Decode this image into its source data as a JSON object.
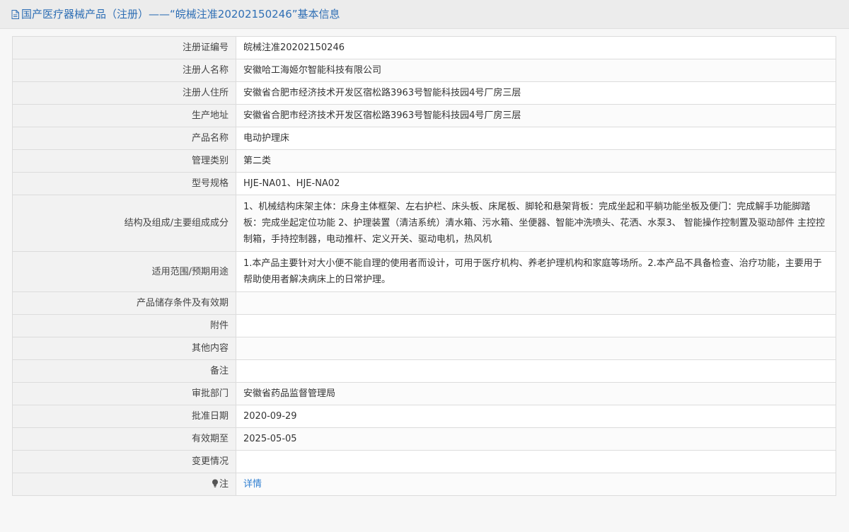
{
  "header": {
    "title": "国产医疗器械产品（注册）——“皖械注准20202150246”基本信息",
    "icon": "document-icon"
  },
  "rows": [
    {
      "label": "注册证编号",
      "value": "皖械注准20202150246"
    },
    {
      "label": "注册人名称",
      "value": "安徽哈工海姬尔智能科技有限公司"
    },
    {
      "label": "注册人住所",
      "value": "安徽省合肥市经济技术开发区宿松路3963号智能科技园4号厂房三层"
    },
    {
      "label": "生产地址",
      "value": "安徽省合肥市经济技术开发区宿松路3963号智能科技园4号厂房三层"
    },
    {
      "label": "产品名称",
      "value": "电动护理床"
    },
    {
      "label": "管理类别",
      "value": "第二类"
    },
    {
      "label": "型号规格",
      "value": "HJE-NA01、HJE-NA02"
    },
    {
      "label": "结构及组成/主要组成成分",
      "value": "1、机械结构床架主体：床身主体框架、左右护栏、床头板、床尾板、脚轮和悬架背板：完成坐起和平躺功能坐板及便门：完成解手功能脚踏板：完成坐起定位功能 2、护理装置（清洁系统）清水箱、污水箱、坐便器、智能冲洗喷头、花洒、水泵3、 智能操作控制置及驱动部件 主控控制箱，手持控制器，电动推杆、定义开关、驱动电机，热风机"
    },
    {
      "label": "适用范围/预期用途",
      "value": "1.本产品主要针对大小便不能自理的使用者而设计，可用于医疗机构、养老护理机构和家庭等场所。2.本产品不具备检查、治疗功能，主要用于帮助使用者解决病床上的日常护理。"
    },
    {
      "label": "产品储存条件及有效期",
      "value": ""
    },
    {
      "label": "附件",
      "value": ""
    },
    {
      "label": "其他内容",
      "value": ""
    },
    {
      "label": "备注",
      "value": ""
    },
    {
      "label": "审批部门",
      "value": "安徽省药品监督管理局"
    },
    {
      "label": "批准日期",
      "value": "2020-09-29"
    },
    {
      "label": "有效期至",
      "value": "2025-05-05"
    },
    {
      "label": "变更情况",
      "value": ""
    }
  ],
  "note": {
    "label": "注",
    "link_text": "详情",
    "icon": "lightbulb-icon"
  },
  "colors": {
    "title_text": "#2f6fb5",
    "link": "#2f7fd0",
    "label_bg": "#f2f2f2",
    "border": "#dcdcdc"
  }
}
